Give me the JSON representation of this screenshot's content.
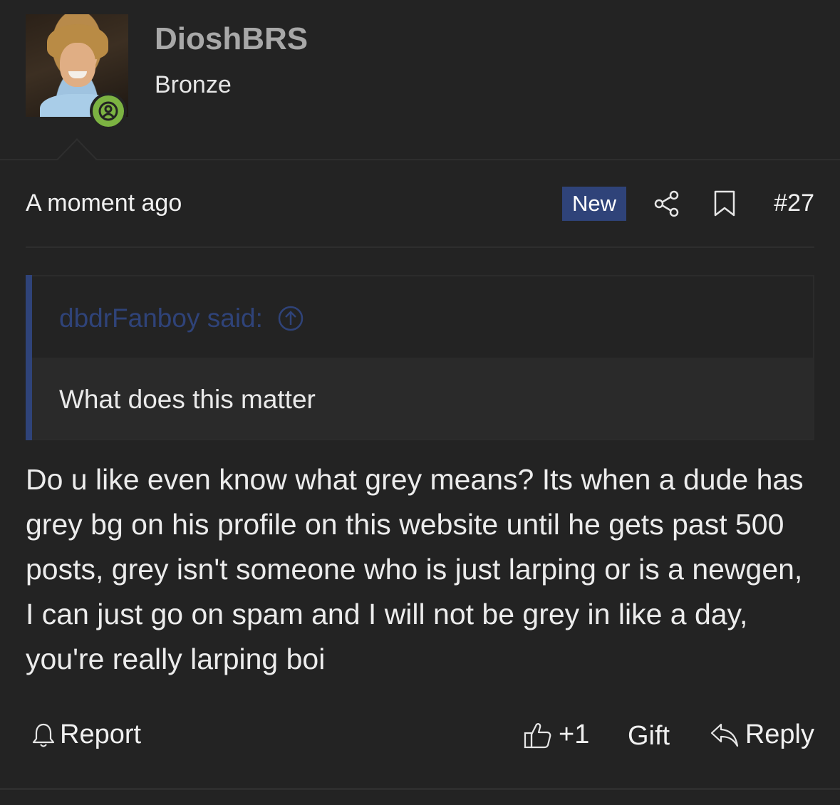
{
  "user": {
    "name": "DioshBRS",
    "rank": "Bronze"
  },
  "post": {
    "timestamp": "A moment ago",
    "new_badge": "New",
    "number": "#27",
    "quote": {
      "author": "dbdrFanboy said:",
      "text": "What does this matter"
    },
    "message": "Do u like even know what grey means? Its when a dude has grey bg on his profile on this website until he gets past 500 posts, grey isn't someone who is just larping or is a newgen, I can just go on spam and I will not be grey in like a day, you're really larping boi"
  },
  "actions": {
    "report_label": "Report",
    "like_label": "+1",
    "gift_label": "Gift",
    "reply_label": "Reply"
  },
  "icons": {
    "online": "user-online-icon",
    "share": "share-icon",
    "bookmark": "bookmark-icon",
    "quote_jump": "arrow-up-circle-icon",
    "report": "bell-icon",
    "like": "thumbs-up-icon",
    "reply": "reply-arrow-icon"
  },
  "colors": {
    "background": "#232323",
    "accent": "#2f4379",
    "online": "#7cb342",
    "username": "#a8a8a8"
  }
}
